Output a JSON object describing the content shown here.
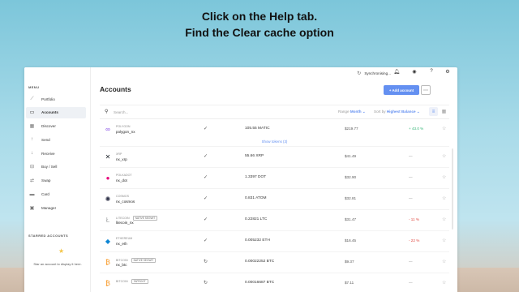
{
  "instructions": {
    "line1": "Click on the Help tab.",
    "line2": "Find the Clear cache option"
  },
  "colors": {
    "accent": "#6490f1",
    "positive": "#35b577",
    "negative": "#e0453d",
    "star": "#f3c548"
  },
  "sidebar": {
    "menu_title": "MENU",
    "items": [
      {
        "label": "Portfolio",
        "icon": "portfolio-icon"
      },
      {
        "label": "Accounts",
        "icon": "accounts-icon",
        "active": true
      },
      {
        "label": "Discover",
        "icon": "discover-icon"
      },
      {
        "label": "Send",
        "icon": "send-icon"
      },
      {
        "label": "Receive",
        "icon": "receive-icon"
      },
      {
        "label": "Buy / Sell",
        "icon": "buy-sell-icon"
      },
      {
        "label": "Swap",
        "icon": "swap-icon"
      },
      {
        "label": "Card",
        "icon": "card-icon"
      },
      {
        "label": "Manager",
        "icon": "manager-icon"
      }
    ],
    "starred_title": "STARRED ACCOUNTS",
    "starred_empty": "Star an account to display it here."
  },
  "topbar": {
    "sync_label": "Synchronising...",
    "icons": [
      "bell-icon",
      "eye-icon",
      "help-icon",
      "settings-icon"
    ]
  },
  "main": {
    "title": "Accounts",
    "add_button": "+ Add account",
    "more_button": "⋯",
    "search_placeholder": "Search...",
    "range_label": "Range",
    "range_value": "Month",
    "sort_label": "Sort by",
    "sort_value": "Highest Balance",
    "show_tokens": "Show tokens (3)",
    "rows": [
      {
        "ticker": "POLYGON",
        "name": "polygon_nx",
        "badge": "",
        "status": "✓",
        "balance": "105.55 MATIC",
        "fiat": "$219.77",
        "change": "+ 43.0 %",
        "change_type": "pos"
      },
      {
        "ticker": "XRP",
        "name": "nx_xrp",
        "badge": "",
        "status": "✓",
        "balance": "55.66 XRP",
        "fiat": "$41.49",
        "change": "—",
        "change_type": "neutral"
      },
      {
        "ticker": "POLKADOT",
        "name": "nx_dot",
        "badge": "",
        "status": "✓",
        "balance": "1.3397 DOT",
        "fiat": "$32.90",
        "change": "—",
        "change_type": "neutral"
      },
      {
        "ticker": "COSMOS",
        "name": "nx_cosmos",
        "badge": "",
        "status": "✓",
        "balance": "0.831 ATOM",
        "fiat": "$32.81",
        "change": "—",
        "change_type": "neutral"
      },
      {
        "ticker": "LITECOIN",
        "name": "litecoin_nx",
        "badge": "NATIVE SEGWIT",
        "status": "✓",
        "balance": "0.22821 LTC",
        "fiat": "$31.47",
        "change": "- 11 %",
        "change_type": "neg"
      },
      {
        "ticker": "ETHEREUM",
        "name": "nx_eth",
        "badge": "",
        "status": "✓",
        "balance": "0.005232 ETH",
        "fiat": "$16.45",
        "change": "- 22 %",
        "change_type": "neg"
      },
      {
        "ticker": "BITCOIN",
        "name": "nx_btc",
        "badge": "NATIVE SEGWIT",
        "status": "↻",
        "balance": "0.00022252 BTC",
        "fiat": "$9.37",
        "change": "—",
        "change_type": "neutral"
      },
      {
        "ticker": "BITCOIN",
        "name": "",
        "badge": "TAPROOT",
        "status": "↻",
        "balance": "0.00016687 BTC",
        "fiat": "$7.11",
        "change": "—",
        "change_type": "neutral"
      }
    ]
  }
}
